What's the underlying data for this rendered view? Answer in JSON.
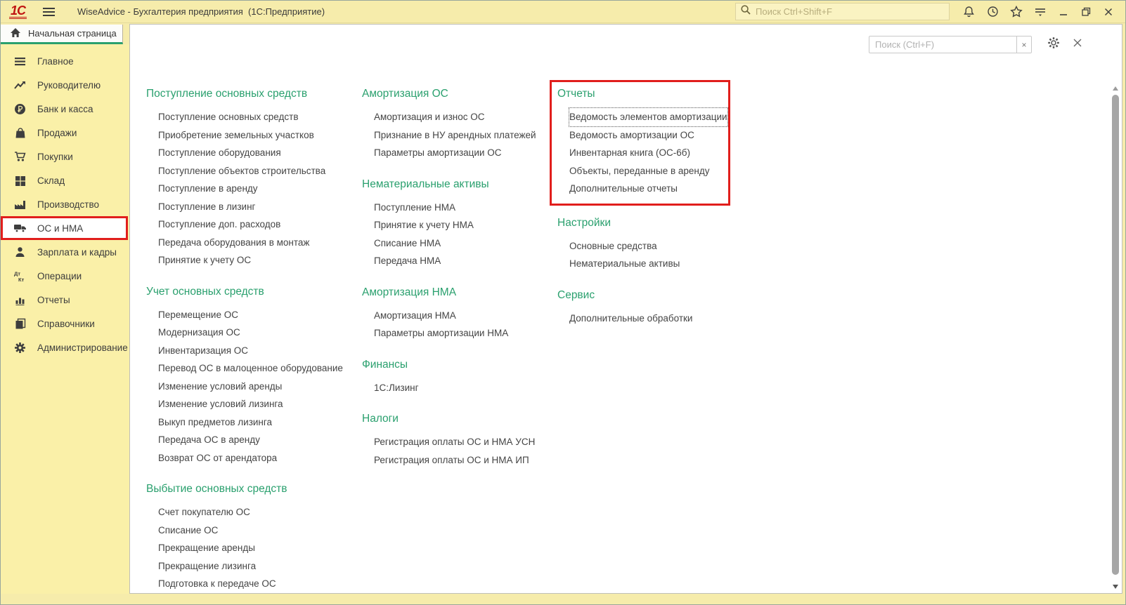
{
  "window": {
    "logo_text": "1С",
    "title": "WiseAdvice - Бухгалтерия предприятия  (1С:Предприятие)",
    "global_search_placeholder": "Поиск Ctrl+Shift+F"
  },
  "tab": {
    "home_label": "Начальная страница"
  },
  "sidebar": {
    "items": [
      {
        "label": "Главное"
      },
      {
        "label": "Руководителю"
      },
      {
        "label": "Банк и касса"
      },
      {
        "label": "Продажи"
      },
      {
        "label": "Покупки"
      },
      {
        "label": "Склад"
      },
      {
        "label": "Производство"
      },
      {
        "label": "ОС и НМА",
        "active": true,
        "highlighted": true
      },
      {
        "label": "Зарплата и кадры"
      },
      {
        "label": "Операции"
      },
      {
        "label": "Отчеты"
      },
      {
        "label": "Справочники"
      },
      {
        "label": "Администрирование"
      }
    ]
  },
  "content": {
    "search_placeholder": "Поиск (Ctrl+F)",
    "clear_label": "×",
    "columns": [
      {
        "groups": [
          {
            "title": "Поступление основных средств",
            "items": [
              "Поступление основных средств",
              "Приобретение земельных участков",
              "Поступление оборудования",
              "Поступление объектов строительства",
              "Поступление в аренду",
              "Поступление в лизинг",
              "Поступление доп. расходов",
              "Передача оборудования в монтаж",
              "Принятие к учету ОС"
            ]
          },
          {
            "title": "Учет основных средств",
            "items": [
              "Перемещение ОС",
              "Модернизация ОС",
              "Инвентаризация ОС",
              "Перевод ОС в малоценное оборудование",
              "Изменение условий аренды",
              "Изменение условий лизинга",
              "Выкуп предметов лизинга",
              "Передача ОС в аренду",
              "Возврат ОС от арендатора"
            ]
          },
          {
            "title": "Выбытие основных средств",
            "items": [
              "Счет покупателю ОС",
              "Списание ОС",
              "Прекращение аренды",
              "Прекращение лизинга",
              "Подготовка к передаче ОС"
            ]
          }
        ]
      },
      {
        "groups": [
          {
            "title": "Амортизация ОС",
            "items": [
              "Амортизация и износ ОС",
              "Признание в НУ арендных платежей",
              "Параметры амортизации ОС"
            ]
          },
          {
            "title": "Нематериальные активы",
            "items": [
              "Поступление НМА",
              "Принятие к учету НМА",
              "Списание НМА",
              "Передача НМА"
            ]
          },
          {
            "title": "Амортизация НМА",
            "items": [
              "Амортизация НМА",
              "Параметры амортизации НМА"
            ]
          },
          {
            "title": "Финансы",
            "items": [
              "1С:Лизинг"
            ]
          },
          {
            "title": "Налоги",
            "items": [
              "Регистрация оплаты ОС и НМА УСН",
              "Регистрация оплаты ОС и НМА ИП"
            ]
          }
        ]
      },
      {
        "groups": [
          {
            "title": "Отчеты",
            "highlighted": true,
            "items": [
              {
                "label": "Ведомость элементов амортизации",
                "focused": true
              },
              "Ведомость амортизации ОС",
              "Инвентарная книга (ОС-6б)",
              "Объекты, переданные в аренду",
              "Дополнительные отчеты"
            ]
          },
          {
            "title": "Настройки",
            "items": [
              "Основные средства",
              "Нематериальные активы"
            ]
          },
          {
            "title": "Сервис",
            "items": [
              "Дополнительные обработки"
            ]
          }
        ]
      }
    ]
  },
  "colors": {
    "titlebar_yellow": "#f6ecab",
    "sidebar_yellow": "#faf0a8",
    "accent_green": "#2aa06e",
    "highlight_red": "#e11e1c",
    "link_text": "#444444"
  }
}
